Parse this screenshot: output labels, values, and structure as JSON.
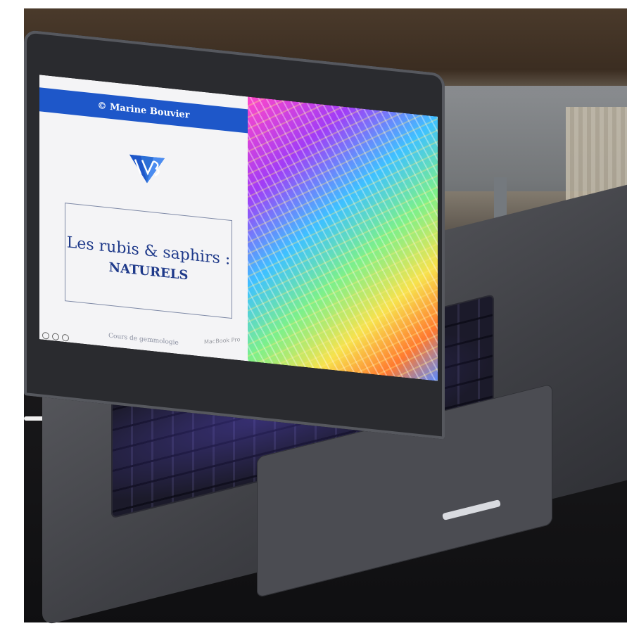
{
  "slide": {
    "banner": "© Marine Bouvier",
    "title_line1": "Les rubis & saphirs :",
    "title_line2": "NATURELS",
    "subtitle": "Cours de gemmologie"
  },
  "laptop": {
    "brand": "MacBook Pro"
  },
  "colors": {
    "banner": "#1e57c9",
    "title_text": "#1f3a8a",
    "laptop_body": "#3f4045"
  },
  "icons": [
    "gem-logo-icon"
  ]
}
